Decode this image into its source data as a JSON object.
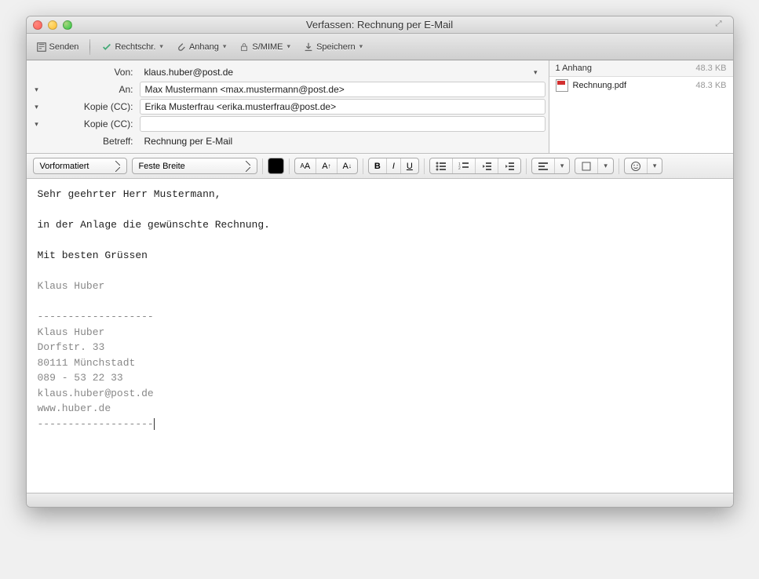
{
  "window": {
    "title": "Verfassen: Rechnung per E-Mail"
  },
  "toolbar": {
    "send": "Senden",
    "spell": "Rechtschr.",
    "attach": "Anhang",
    "smime": "S/MIME",
    "save": "Speichern"
  },
  "fields": {
    "from_label": "Von:",
    "from_value": "klaus.huber@post.de",
    "to_label": "An:",
    "to_value": "Max Mustermann <max.mustermann@post.de>",
    "cc_label": "Kopie (CC):",
    "cc_value": "Erika Musterfrau <erika.musterfrau@post.de>",
    "cc2_label": "Kopie (CC):",
    "cc2_value": "",
    "subject_label": "Betreff:",
    "subject_value": "Rechnung per E-Mail"
  },
  "attachments": {
    "header": "1 Anhang",
    "total_size": "48.3 KB",
    "item_name": "Rechnung.pdf",
    "item_size": "48.3 KB"
  },
  "format": {
    "paragraph": "Vorformatiert",
    "font": "Feste Breite"
  },
  "body": {
    "greeting": "Sehr geehrter Herr Mustermann,",
    "line1": "in der Anlage die gewünschte Rechnung.",
    "closing": "Mit besten Grüssen",
    "name": "Klaus Huber",
    "sig_sep": "-------------------",
    "sig_name": "Klaus Huber",
    "sig_street": "Dorfstr. 33",
    "sig_city": "80111 Münchstadt",
    "sig_phone": "089 - 53 22 33",
    "sig_email": "klaus.huber@post.de",
    "sig_web": "www.huber.de",
    "sig_sep2": "-------------------"
  }
}
